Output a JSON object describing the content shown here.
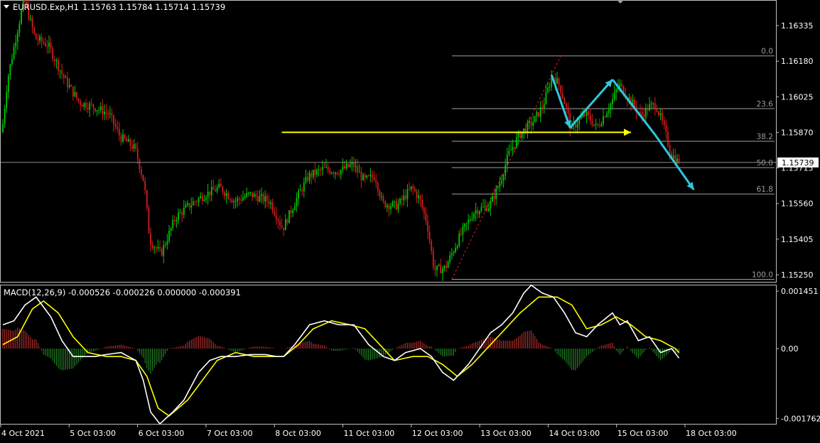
{
  "header": {
    "symbol_label": "EURUSD.Exp,H1",
    "ohlc": "1.15763 1.15784 1.15714 1.15739"
  },
  "indicator": {
    "label": "MACD(12,26,9) -0.000526 -0.000226 0.000000 -0.000391"
  },
  "time_axis": [
    "4 Oct 2021",
    "5 Oct 03:00",
    "6 Oct 03:00",
    "7 Oct 03:00",
    "8 Oct 03:00",
    "11 Oct 03:00",
    "12 Oct 03:00",
    "13 Oct 03:00",
    "14 Oct 03:00",
    "15 Oct 03:00",
    "18 Oct 03:00"
  ],
  "colors": {
    "background": "#000000",
    "bull_candle": "#00c800",
    "bear_candle": "#d21e1e",
    "grid_line": "#c0c0c0",
    "fib_line": "#a0a0a0",
    "arrow_yellow": "#ffff00",
    "arrow_cyan": "#2ec8dc",
    "macd_line": "#ffffff",
    "signal_line": "#ffff00",
    "hist_pos": "#c83232",
    "hist_neg": "#289628"
  },
  "chart_data": [
    {
      "type": "candlestick",
      "title": "EURUSD.Exp,H1",
      "y_axis_ticks": [
        "1.16335",
        "1.16180",
        "1.16025",
        "1.15870",
        "1.15715",
        "1.15560",
        "1.15405",
        "1.15250"
      ],
      "ylim": [
        1.1517,
        1.1649
      ],
      "x_axis": "time",
      "current_price": "1.15739",
      "price_path": [
        [
          0,
          1.1587
        ],
        [
          3,
          1.161
        ],
        [
          8,
          1.163
        ],
        [
          12,
          1.1645
        ],
        [
          18,
          1.1628
        ],
        [
          25,
          1.1625
        ],
        [
          34,
          1.161
        ],
        [
          42,
          1.16
        ],
        [
          50,
          1.1598
        ],
        [
          58,
          1.1595
        ],
        [
          64,
          1.1585
        ],
        [
          72,
          1.158
        ],
        [
          77,
          1.1565
        ],
        [
          80,
          1.154
        ],
        [
          86,
          1.1534
        ],
        [
          94,
          1.155
        ],
        [
          101,
          1.1555
        ],
        [
          110,
          1.156
        ],
        [
          118,
          1.1563
        ],
        [
          126,
          1.1557
        ],
        [
          134,
          1.156
        ],
        [
          145,
          1.1557
        ],
        [
          152,
          1.1545
        ],
        [
          160,
          1.1559
        ],
        [
          166,
          1.1568
        ],
        [
          174,
          1.1571
        ],
        [
          182,
          1.157
        ],
        [
          190,
          1.1573
        ],
        [
          196,
          1.1566
        ],
        [
          202,
          1.1568
        ],
        [
          206,
          1.1556
        ],
        [
          214,
          1.1555
        ],
        [
          222,
          1.1563
        ],
        [
          226,
          1.1558
        ],
        [
          230,
          1.1548
        ],
        [
          234,
          1.1527
        ],
        [
          240,
          1.1528
        ],
        [
          248,
          1.1542
        ],
        [
          256,
          1.1553
        ],
        [
          264,
          1.1555
        ],
        [
          270,
          1.1566
        ],
        [
          274,
          1.1577
        ],
        [
          280,
          1.1586
        ],
        [
          288,
          1.1592
        ],
        [
          293,
          1.1599
        ],
        [
          298,
          1.1612
        ],
        [
          302,
          1.1607
        ],
        [
          306,
          1.1596
        ],
        [
          308,
          1.1588
        ],
        [
          312,
          1.1592
        ],
        [
          316,
          1.1595
        ],
        [
          322,
          1.1589
        ],
        [
          330,
          1.16
        ],
        [
          334,
          1.1608
        ],
        [
          338,
          1.1603
        ],
        [
          342,
          1.1599
        ],
        [
          346,
          1.1594
        ],
        [
          350,
          1.1598
        ],
        [
          354,
          1.1599
        ],
        [
          358,
          1.159
        ],
        [
          362,
          1.1578
        ],
        [
          366,
          1.1574
        ]
      ],
      "fibonacci_retracement": {
        "high": 1.16203,
        "low": 1.1523,
        "levels": [
          {
            "label": "0.0",
            "ratio": 0.0
          },
          {
            "label": "23.6",
            "ratio": 0.236
          },
          {
            "label": "38.2",
            "ratio": 0.382
          },
          {
            "label": "50.0",
            "ratio": 0.5
          },
          {
            "label": "61.8",
            "ratio": 0.618
          },
          {
            "label": "100.0",
            "ratio": 1.0
          }
        ]
      },
      "annotations": [
        {
          "type": "arrow",
          "color": "yellow",
          "from": [
            151,
            1.1587
          ],
          "to": [
            340,
            1.1587
          ]
        },
        {
          "type": "arrow",
          "color": "cyan",
          "from": [
            297,
            1.1612
          ],
          "to": [
            307,
            1.1589
          ]
        },
        {
          "type": "arrow",
          "color": "cyan",
          "from": [
            307,
            1.1589
          ],
          "to": [
            330,
            1.161
          ]
        },
        {
          "type": "line",
          "color": "cyan",
          "from": [
            330,
            1.161
          ],
          "to": [
            353,
            1.1586
          ]
        },
        {
          "type": "arrow",
          "color": "cyan",
          "from": [
            353,
            1.1586
          ],
          "to": [
            374,
            1.1562
          ]
        }
      ]
    },
    {
      "type": "line",
      "title": "MACD(12,26,9)",
      "y_axis_ticks": [
        "0.001451",
        "0.00",
        "-0.001762"
      ],
      "ylim": [
        -0.00185,
        0.00158
      ],
      "macd_path": [
        [
          0,
          0.0006
        ],
        [
          6,
          0.0007
        ],
        [
          12,
          0.0011
        ],
        [
          18,
          0.0013
        ],
        [
          26,
          0.0008
        ],
        [
          32,
          0.0002
        ],
        [
          38,
          -0.0002
        ],
        [
          44,
          -0.0002
        ],
        [
          50,
          -0.0002
        ],
        [
          56,
          -0.00015
        ],
        [
          64,
          -0.0001
        ],
        [
          72,
          -0.0003
        ],
        [
          76,
          -0.0008
        ],
        [
          80,
          -0.0016
        ],
        [
          85,
          -0.0019
        ],
        [
          92,
          -0.0016
        ],
        [
          98,
          -0.0013
        ],
        [
          106,
          -0.0006
        ],
        [
          112,
          -0.0003
        ],
        [
          118,
          -0.0002
        ],
        [
          126,
          -0.0002
        ],
        [
          134,
          -0.00015
        ],
        [
          142,
          -0.00015
        ],
        [
          148,
          -0.0002
        ],
        [
          152,
          -0.0002
        ],
        [
          158,
          0.0001
        ],
        [
          166,
          0.0006
        ],
        [
          174,
          0.0007
        ],
        [
          182,
          0.0006
        ],
        [
          190,
          0.0006
        ],
        [
          198,
          0.0001
        ],
        [
          206,
          -0.0002
        ],
        [
          212,
          -0.0003
        ],
        [
          218,
          -0.0001
        ],
        [
          226,
          0.0
        ],
        [
          232,
          -0.0002
        ],
        [
          238,
          -0.0006
        ],
        [
          244,
          -0.0008
        ],
        [
          252,
          -0.0004
        ],
        [
          258,
          0.0
        ],
        [
          264,
          0.0004
        ],
        [
          270,
          0.0006
        ],
        [
          276,
          0.0009
        ],
        [
          282,
          0.0014
        ],
        [
          286,
          0.0016
        ],
        [
          292,
          0.0014
        ],
        [
          298,
          0.0013
        ],
        [
          304,
          0.0009
        ],
        [
          310,
          0.0004
        ],
        [
          316,
          0.0003
        ],
        [
          322,
          0.0006
        ],
        [
          330,
          0.0009
        ],
        [
          334,
          0.0006
        ],
        [
          338,
          0.0007
        ],
        [
          344,
          0.0002
        ],
        [
          350,
          0.0003
        ],
        [
          356,
          -0.0001
        ],
        [
          362,
          0.0
        ],
        [
          367,
          -0.0003
        ],
        [
          370,
          -0.0006
        ]
      ],
      "signal_path": [
        [
          0,
          0.0001
        ],
        [
          8,
          0.0003
        ],
        [
          16,
          0.001
        ],
        [
          22,
          0.0012
        ],
        [
          30,
          0.0009
        ],
        [
          38,
          0.0003
        ],
        [
          46,
          -0.0001
        ],
        [
          56,
          -0.0002
        ],
        [
          64,
          -0.0002
        ],
        [
          72,
          -0.0003
        ],
        [
          78,
          -0.0007
        ],
        [
          84,
          -0.0015
        ],
        [
          90,
          -0.0017
        ],
        [
          100,
          -0.0013
        ],
        [
          108,
          -0.0008
        ],
        [
          116,
          -0.0003
        ],
        [
          126,
          -0.0001
        ],
        [
          136,
          -0.0002
        ],
        [
          146,
          -0.0002
        ],
        [
          152,
          -0.0002
        ],
        [
          160,
          0.0001
        ],
        [
          168,
          0.0005
        ],
        [
          178,
          0.0007
        ],
        [
          188,
          0.0006
        ],
        [
          196,
          0.0005
        ],
        [
          204,
          0.0001
        ],
        [
          212,
          -0.0003
        ],
        [
          222,
          -0.0002
        ],
        [
          230,
          -0.0002
        ],
        [
          238,
          -0.0004
        ],
        [
          246,
          -0.0007
        ],
        [
          254,
          -0.0004
        ],
        [
          262,
          0.0
        ],
        [
          270,
          0.0004
        ],
        [
          280,
          0.0009
        ],
        [
          290,
          0.0013
        ],
        [
          300,
          0.0013
        ],
        [
          308,
          0.0011
        ],
        [
          316,
          0.0005
        ],
        [
          324,
          0.0006
        ],
        [
          332,
          0.0008
        ],
        [
          340,
          0.0006
        ],
        [
          348,
          0.0003
        ],
        [
          356,
          0.0002
        ],
        [
          364,
          0.0
        ],
        [
          370,
          -0.0003
        ]
      ]
    }
  ]
}
